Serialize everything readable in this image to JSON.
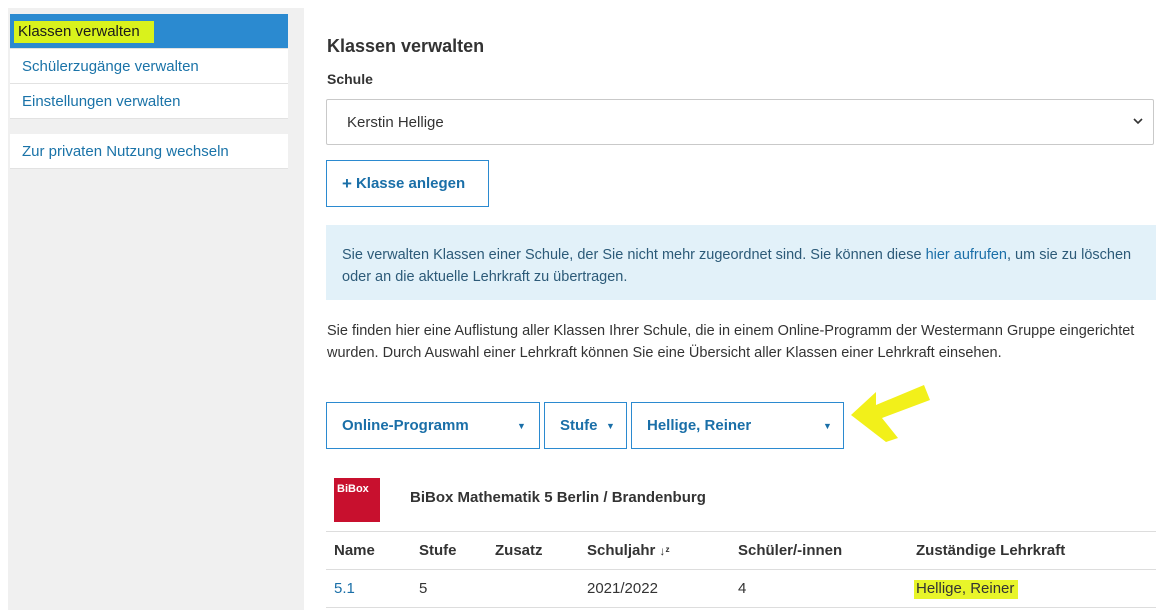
{
  "sidebar": {
    "items": [
      {
        "label": "Klassen verwalten"
      },
      {
        "label": "Schülerzugänge verwalten"
      },
      {
        "label": "Einstellungen verwalten"
      }
    ],
    "private_link": "Zur privaten Nutzung wechseln"
  },
  "main": {
    "title": "Klassen verwalten",
    "school_label": "Schule",
    "school_value": "Kerstin Hellige",
    "add_button": "Klasse anlegen",
    "info_text_before": "Sie verwalten Klassen einer Schule, der Sie nicht mehr zugeordnet sind. Sie können diese ",
    "info_link": "hier aufrufen",
    "info_text_after": ", um sie zu löschen oder an die aktuelle Lehrkraft zu übertragen.",
    "description": "Sie finden hier eine Auflistung aller Klassen Ihrer Schule, die in einem Online-Programm der Westermann Gruppe eingerichtet wurden. Durch Auswahl einer Lehrkraft können Sie eine Übersicht aller Klassen einer Lehrkraft einsehen.",
    "filters": {
      "program": "Online-Programm",
      "level": "Stufe",
      "teacher": "Hellige, Reiner"
    },
    "program_logo": "BiBox",
    "program_name": "BiBox Mathematik 5 Berlin / Brandenburg",
    "table": {
      "headers": [
        "Name",
        "Stufe",
        "Zusatz",
        "Schuljahr",
        "Schüler/-innen",
        "Zuständige Lehrkraft"
      ],
      "rows": [
        {
          "name": "5.1",
          "stufe": "5",
          "zusatz": "",
          "schuljahr": "2021/2022",
          "schueler": "4",
          "lehrkraft": "Hellige, Reiner"
        }
      ]
    }
  },
  "colors": {
    "accent": "#2b8ad0",
    "link": "#1a6fa8",
    "info_bg": "#e2f1f9",
    "highlight": "#e8f52a",
    "logo_red": "#c8102e"
  }
}
